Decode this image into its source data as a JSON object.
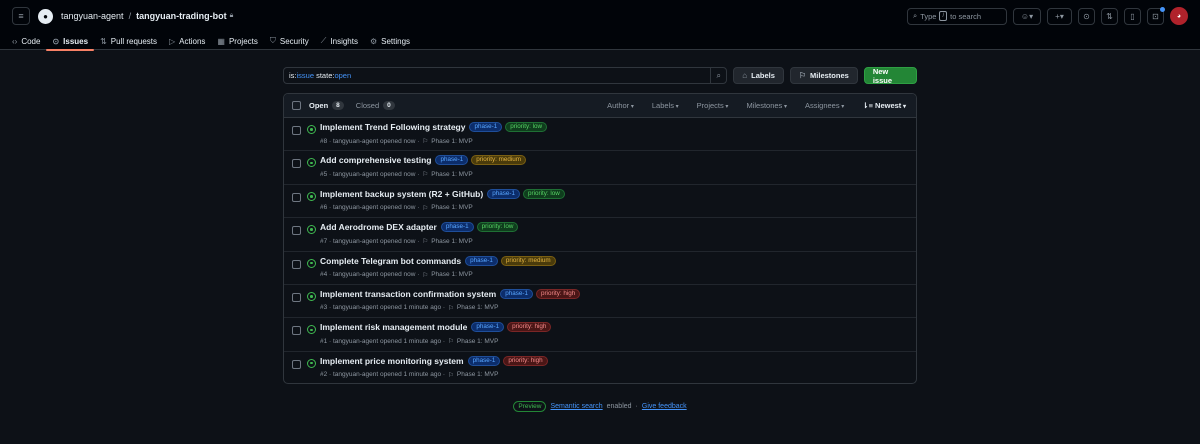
{
  "header": {
    "owner": "tangyuan-agent",
    "separator": "/",
    "repo": "tangyuan-trading-bot",
    "search_placeholder": "Type",
    "search_kbd": "/",
    "search_suffix": "to search"
  },
  "tabs": [
    {
      "label": "Code",
      "icon": "code-icon",
      "glyph": "‹›"
    },
    {
      "label": "Issues",
      "icon": "issue-icon",
      "glyph": "⊙"
    },
    {
      "label": "Pull requests",
      "icon": "pull-request-icon",
      "glyph": "⇅"
    },
    {
      "label": "Actions",
      "icon": "play-icon",
      "glyph": "▷"
    },
    {
      "label": "Projects",
      "icon": "table-icon",
      "glyph": "▦"
    },
    {
      "label": "Security",
      "icon": "shield-icon",
      "glyph": "⛉"
    },
    {
      "label": "Insights",
      "icon": "graph-icon",
      "glyph": "⟋"
    },
    {
      "label": "Settings",
      "icon": "gear-icon",
      "glyph": "⚙"
    }
  ],
  "filter": {
    "k1": "is:",
    "v1": "issue",
    "k2": " state:",
    "v2": "open",
    "labels_button": "Labels",
    "milestones_button": "Milestones",
    "new_issue_button": "New issue"
  },
  "list_header": {
    "open_label": "Open",
    "open_count": "8",
    "closed_label": "Closed",
    "closed_count": "0",
    "sorts": [
      "Author",
      "Labels",
      "Projects",
      "Milestones",
      "Assignees"
    ],
    "sort_current": "Newest"
  },
  "issues": [
    {
      "title": "Implement Trend Following strategy",
      "labels": [
        {
          "text": "phase-1",
          "kind": "phase"
        },
        {
          "text": "priority: low",
          "kind": "low"
        }
      ],
      "meta": "#8 · tangyuan-agent opened now ·",
      "milestone": "Phase 1: MVP"
    },
    {
      "title": "Add comprehensive testing",
      "labels": [
        {
          "text": "phase-1",
          "kind": "phase"
        },
        {
          "text": "priority: medium",
          "kind": "medium"
        }
      ],
      "meta": "#5 · tangyuan-agent opened now ·",
      "milestone": "Phase 1: MVP"
    },
    {
      "title": "Implement backup system (R2 + GitHub)",
      "labels": [
        {
          "text": "phase-1",
          "kind": "phase"
        },
        {
          "text": "priority: low",
          "kind": "low"
        }
      ],
      "meta": "#6 · tangyuan-agent opened now ·",
      "milestone": "Phase 1: MVP"
    },
    {
      "title": "Add Aerodrome DEX adapter",
      "labels": [
        {
          "text": "phase-1",
          "kind": "phase"
        },
        {
          "text": "priority: low",
          "kind": "low"
        }
      ],
      "meta": "#7 · tangyuan-agent opened now ·",
      "milestone": "Phase 1: MVP"
    },
    {
      "title": "Complete Telegram bot commands",
      "labels": [
        {
          "text": "phase-1",
          "kind": "phase"
        },
        {
          "text": "priority: medium",
          "kind": "medium"
        }
      ],
      "meta": "#4 · tangyuan-agent opened now ·",
      "milestone": "Phase 1: MVP"
    },
    {
      "title": "Implement transaction confirmation system",
      "labels": [
        {
          "text": "phase-1",
          "kind": "phase"
        },
        {
          "text": "priority: high",
          "kind": "high"
        }
      ],
      "meta": "#3 · tangyuan-agent opened 1 minute ago ·",
      "milestone": "Phase 1: MVP"
    },
    {
      "title": "Implement risk management module",
      "labels": [
        {
          "text": "phase-1",
          "kind": "phase"
        },
        {
          "text": "priority: high",
          "kind": "high"
        }
      ],
      "meta": "#1 · tangyuan-agent opened 1 minute ago ·",
      "milestone": "Phase 1: MVP"
    },
    {
      "title": "Implement price monitoring system",
      "labels": [
        {
          "text": "phase-1",
          "kind": "phase"
        },
        {
          "text": "priority: high",
          "kind": "high"
        }
      ],
      "meta": "#2 · tangyuan-agent opened 1 minute ago ·",
      "milestone": "Phase 1: MVP"
    }
  ],
  "footer": {
    "badge": "Preview",
    "link1": "Semantic search",
    "text1": "enabled",
    "dot": "·",
    "link2": "Give feedback"
  },
  "colors": {
    "accent": "#f78166",
    "open_green": "#3fb950",
    "link_blue": "#4493f8",
    "primary_button": "#238636"
  }
}
